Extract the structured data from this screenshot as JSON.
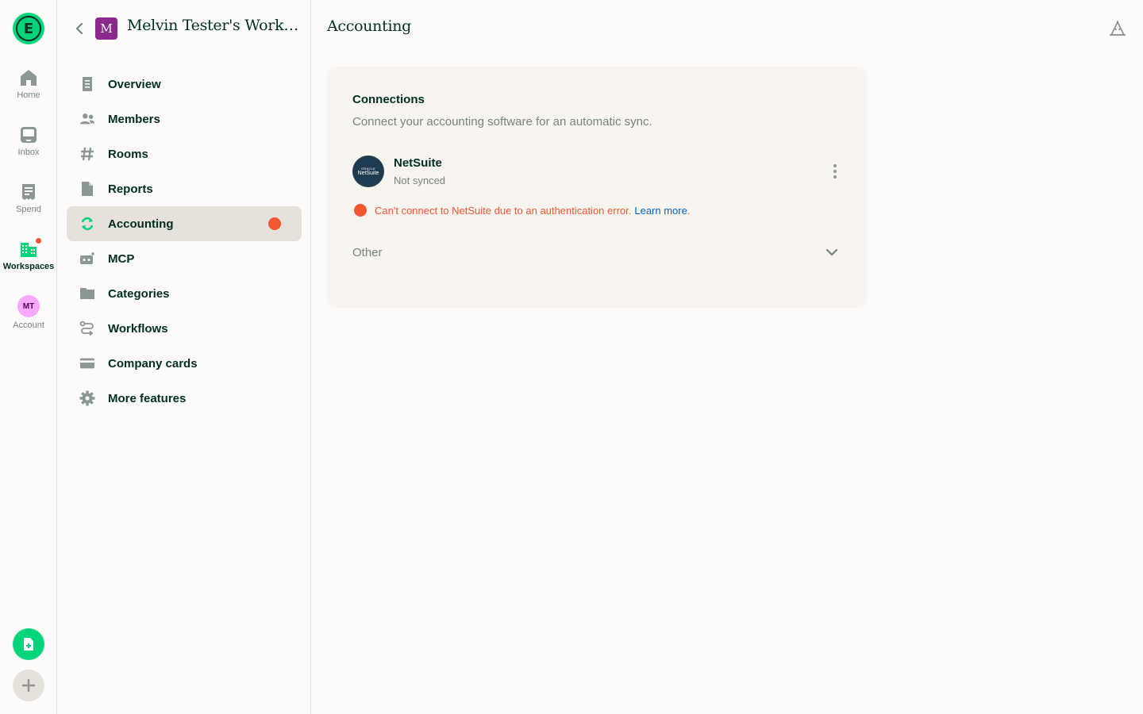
{
  "rail": {
    "logo_letter": "E",
    "items": [
      {
        "label": "Home",
        "icon": "home-icon"
      },
      {
        "label": "Inbox",
        "icon": "inbox-icon"
      },
      {
        "label": "Spend",
        "icon": "receipt-icon"
      },
      {
        "label": "Workspaces",
        "icon": "building-icon"
      },
      {
        "label": "Account",
        "icon": "avatar",
        "initials": "MT"
      }
    ],
    "fab_green_icon": "new-expense-icon",
    "fab_grey_icon": "plus-icon"
  },
  "sidebar": {
    "workspace_initial": "M",
    "workspace_name": "Melvin Tester's Workspace",
    "items": [
      {
        "label": "Overview",
        "icon": "document-icon"
      },
      {
        "label": "Members",
        "icon": "users-icon"
      },
      {
        "label": "Rooms",
        "icon": "hashtag-icon"
      },
      {
        "label": "Reports",
        "icon": "file-icon"
      },
      {
        "label": "Accounting",
        "icon": "sync-icon",
        "active": true,
        "alert": true
      },
      {
        "label": "MCP",
        "icon": "mcp-icon"
      },
      {
        "label": "Categories",
        "icon": "folder-icon"
      },
      {
        "label": "Workflows",
        "icon": "workflow-icon"
      },
      {
        "label": "Company cards",
        "icon": "card-icon"
      },
      {
        "label": "More features",
        "icon": "gear-icon"
      }
    ]
  },
  "main": {
    "title": "Accounting",
    "help_icon": "concierge-icon",
    "connections": {
      "title": "Connections",
      "subtitle": "Connect your accounting software for an automatic sync.",
      "integration": {
        "logo_line1": "ORACLE",
        "logo_line2": "NetSuite",
        "name": "NetSuite",
        "status": "Not synced"
      },
      "error": {
        "text": "Can't connect to NetSuite due to an authentication error.",
        "link": "Learn more",
        "suffix": "."
      },
      "other_label": "Other"
    }
  },
  "colors": {
    "brand_green": "#03d47c",
    "error": "#f25730",
    "link": "#0164bf",
    "text": "#002e22",
    "muted": "#76847e"
  }
}
